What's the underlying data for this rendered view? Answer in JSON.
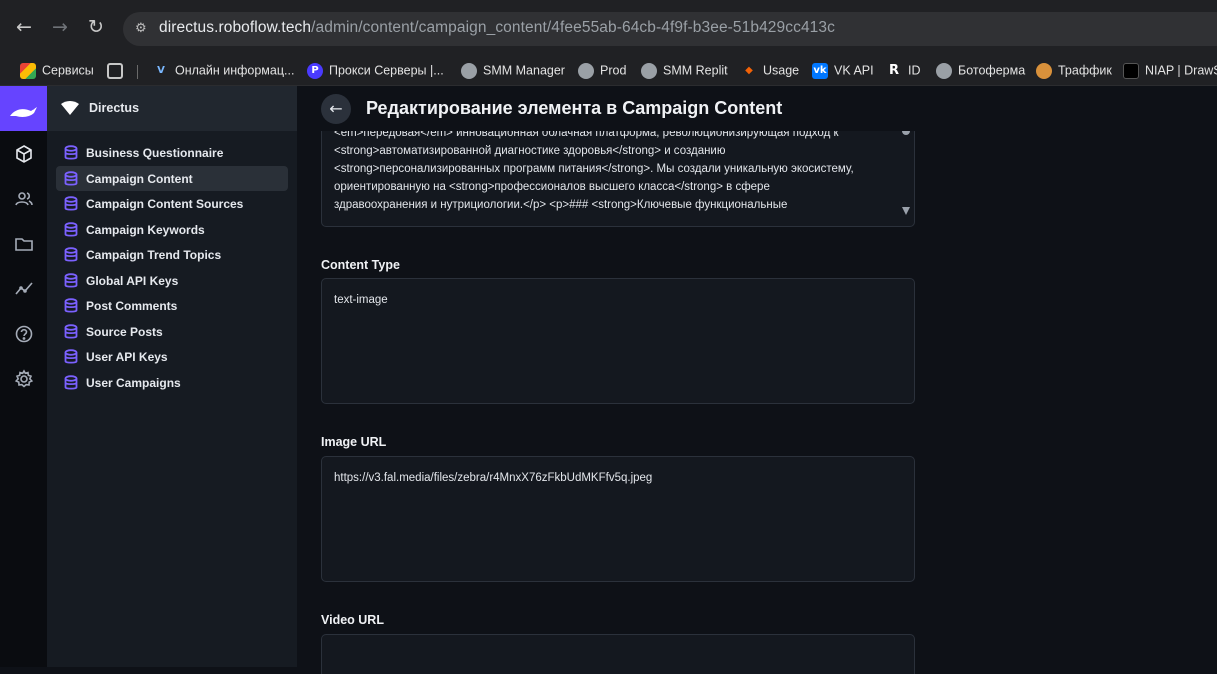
{
  "browser": {
    "url_host": "directus.roboflow.tech",
    "url_path": "/admin/content/campaign_content/4fee55ab-64cb-4f9f-b3ee-51b429cc413c",
    "bookmarks": [
      {
        "label": "Сервисы",
        "icon": "apps-grid-icon"
      },
      {
        "label": "",
        "icon": "grid-icon"
      },
      {
        "label": "Онлайн информац...",
        "icon": "v-logo-icon"
      },
      {
        "label": "Прокси Серверы |...",
        "icon": "proxy-logo-icon"
      },
      {
        "label": "SMM Manager",
        "icon": "globe-icon"
      },
      {
        "label": "Prod",
        "icon": "globe-icon"
      },
      {
        "label": "SMM Replit",
        "icon": "globe-icon"
      },
      {
        "label": "Usage",
        "icon": "usage-icon"
      },
      {
        "label": "VK API",
        "icon": "vk-icon"
      },
      {
        "label": "ID",
        "icon": "r-icon"
      },
      {
        "label": "Ботоферма",
        "icon": "globe-icon"
      },
      {
        "label": "Траффик",
        "icon": "avatar-icon"
      },
      {
        "label": "NIAP | DrawSQ",
        "icon": "niap-icon"
      }
    ]
  },
  "sidebar": {
    "project": "Directus",
    "items": [
      {
        "label": "Business Questionnaire",
        "active": false
      },
      {
        "label": "Campaign Content",
        "active": true
      },
      {
        "label": "Campaign Content Sources",
        "active": false
      },
      {
        "label": "Campaign Keywords",
        "active": false
      },
      {
        "label": "Campaign Trend Topics",
        "active": false
      },
      {
        "label": "Global API Keys",
        "active": false
      },
      {
        "label": "Post Comments",
        "active": false
      },
      {
        "label": "Source Posts",
        "active": false
      },
      {
        "label": "User API Keys",
        "active": false
      },
      {
        "label": "User Campaigns",
        "active": false
      }
    ]
  },
  "header": {
    "title": "Редактирование элемента в Campaign Content"
  },
  "content_field": {
    "lines": [
      "<em>передовая</em> инновационная облачная платформа, революционизирующая подход к",
      "<strong>автоматизированной диагностике здоровья</strong> и созданию",
      "<strong>персонализированных программ питания</strong>. Мы создали уникальную экосистему,",
      "ориентированную на <strong>профессионалов высшего класса</strong> в сфере",
      "здравоохранения и нутрициологии.</p> <p>### <strong>Ключевые функциональные"
    ]
  },
  "fields": {
    "content_type": {
      "label": "Content Type",
      "value": "text-image"
    },
    "image_url": {
      "label": "Image URL",
      "value": "https://v3.fal.media/files/zebra/r4MnxX76zFkbUdMKFfv5q.jpeg"
    },
    "video_url": {
      "label": "Video URL",
      "value": ""
    }
  },
  "colors": {
    "accent": "#6644ff",
    "background": "#0e1117",
    "sidebar": "#161b22",
    "collection_icon": "#7b61ff"
  }
}
